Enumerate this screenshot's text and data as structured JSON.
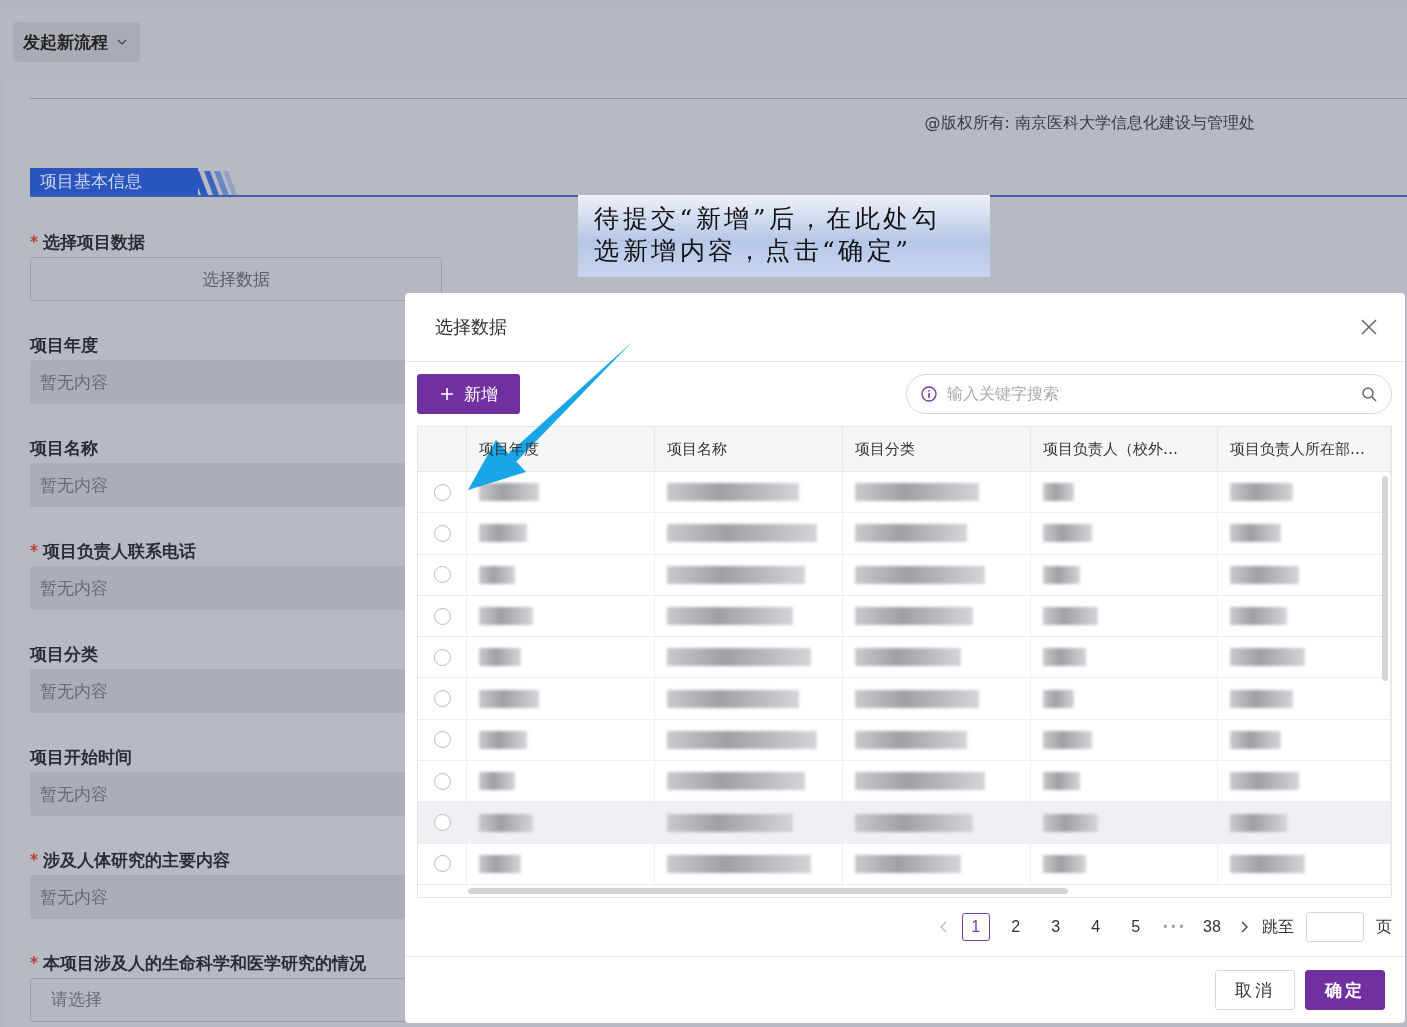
{
  "top_bar": {
    "menu_button": "发起新流程"
  },
  "copyright": "@版权所有: 南京医科大学信息化建设与管理处",
  "section_title": "项目基本信息",
  "form_fields": [
    {
      "label": "选择项目数据",
      "required": true,
      "kind": "button",
      "value": "选择数据"
    },
    {
      "label": "项目年度",
      "required": false,
      "kind": "readonly",
      "placeholder": "暂无内容"
    },
    {
      "label": "项目名称",
      "required": false,
      "kind": "readonly",
      "placeholder": "暂无内容"
    },
    {
      "label": "项目负责人联系电话",
      "required": true,
      "kind": "readonly",
      "placeholder": "暂无内容"
    },
    {
      "label": "项目分类",
      "required": false,
      "kind": "readonly",
      "placeholder": "暂无内容"
    },
    {
      "label": "项目开始时间",
      "required": false,
      "kind": "readonly",
      "placeholder": "暂无内容"
    },
    {
      "label": "涉及人体研究的主要内容",
      "required": true,
      "kind": "readonly",
      "placeholder": "暂无内容"
    },
    {
      "label": "本项目涉及人的生命科学和医学研究的情况",
      "required": true,
      "kind": "select",
      "placeholder": "请选择"
    }
  ],
  "callout": "待提交“新增”后，在此处勾选新增内容，点击“确定”",
  "dialog": {
    "title": "选择数据",
    "add_button": "新增",
    "search": {
      "placeholder": "输入关键字搜索"
    },
    "table": {
      "columns": [
        "项目年度",
        "项目名称",
        "项目分类",
        "项目负责人（校外…",
        "项目负责人所在部…"
      ],
      "rows": [
        {
          "selected": false,
          "highlighted": false
        },
        {
          "selected": false,
          "highlighted": false
        },
        {
          "selected": false,
          "highlighted": false
        },
        {
          "selected": false,
          "highlighted": false
        },
        {
          "selected": false,
          "highlighted": false
        },
        {
          "selected": false,
          "highlighted": false
        },
        {
          "selected": false,
          "highlighted": false
        },
        {
          "selected": false,
          "highlighted": false
        },
        {
          "selected": false,
          "highlighted": true
        },
        {
          "selected": false,
          "highlighted": false
        }
      ]
    },
    "pagination": {
      "pages": [
        {
          "label": "1",
          "selected": true
        },
        {
          "label": "2",
          "selected": false
        },
        {
          "label": "3",
          "selected": false
        },
        {
          "label": "4",
          "selected": false
        },
        {
          "label": "5",
          "selected": false
        }
      ],
      "ellipsis": "•••",
      "last_page": "38",
      "jump_label": "跳至",
      "page_suffix": "页"
    },
    "buttons": [
      {
        "label": "取消",
        "kind": "default"
      },
      {
        "label": "确定",
        "kind": "primary"
      }
    ]
  }
}
